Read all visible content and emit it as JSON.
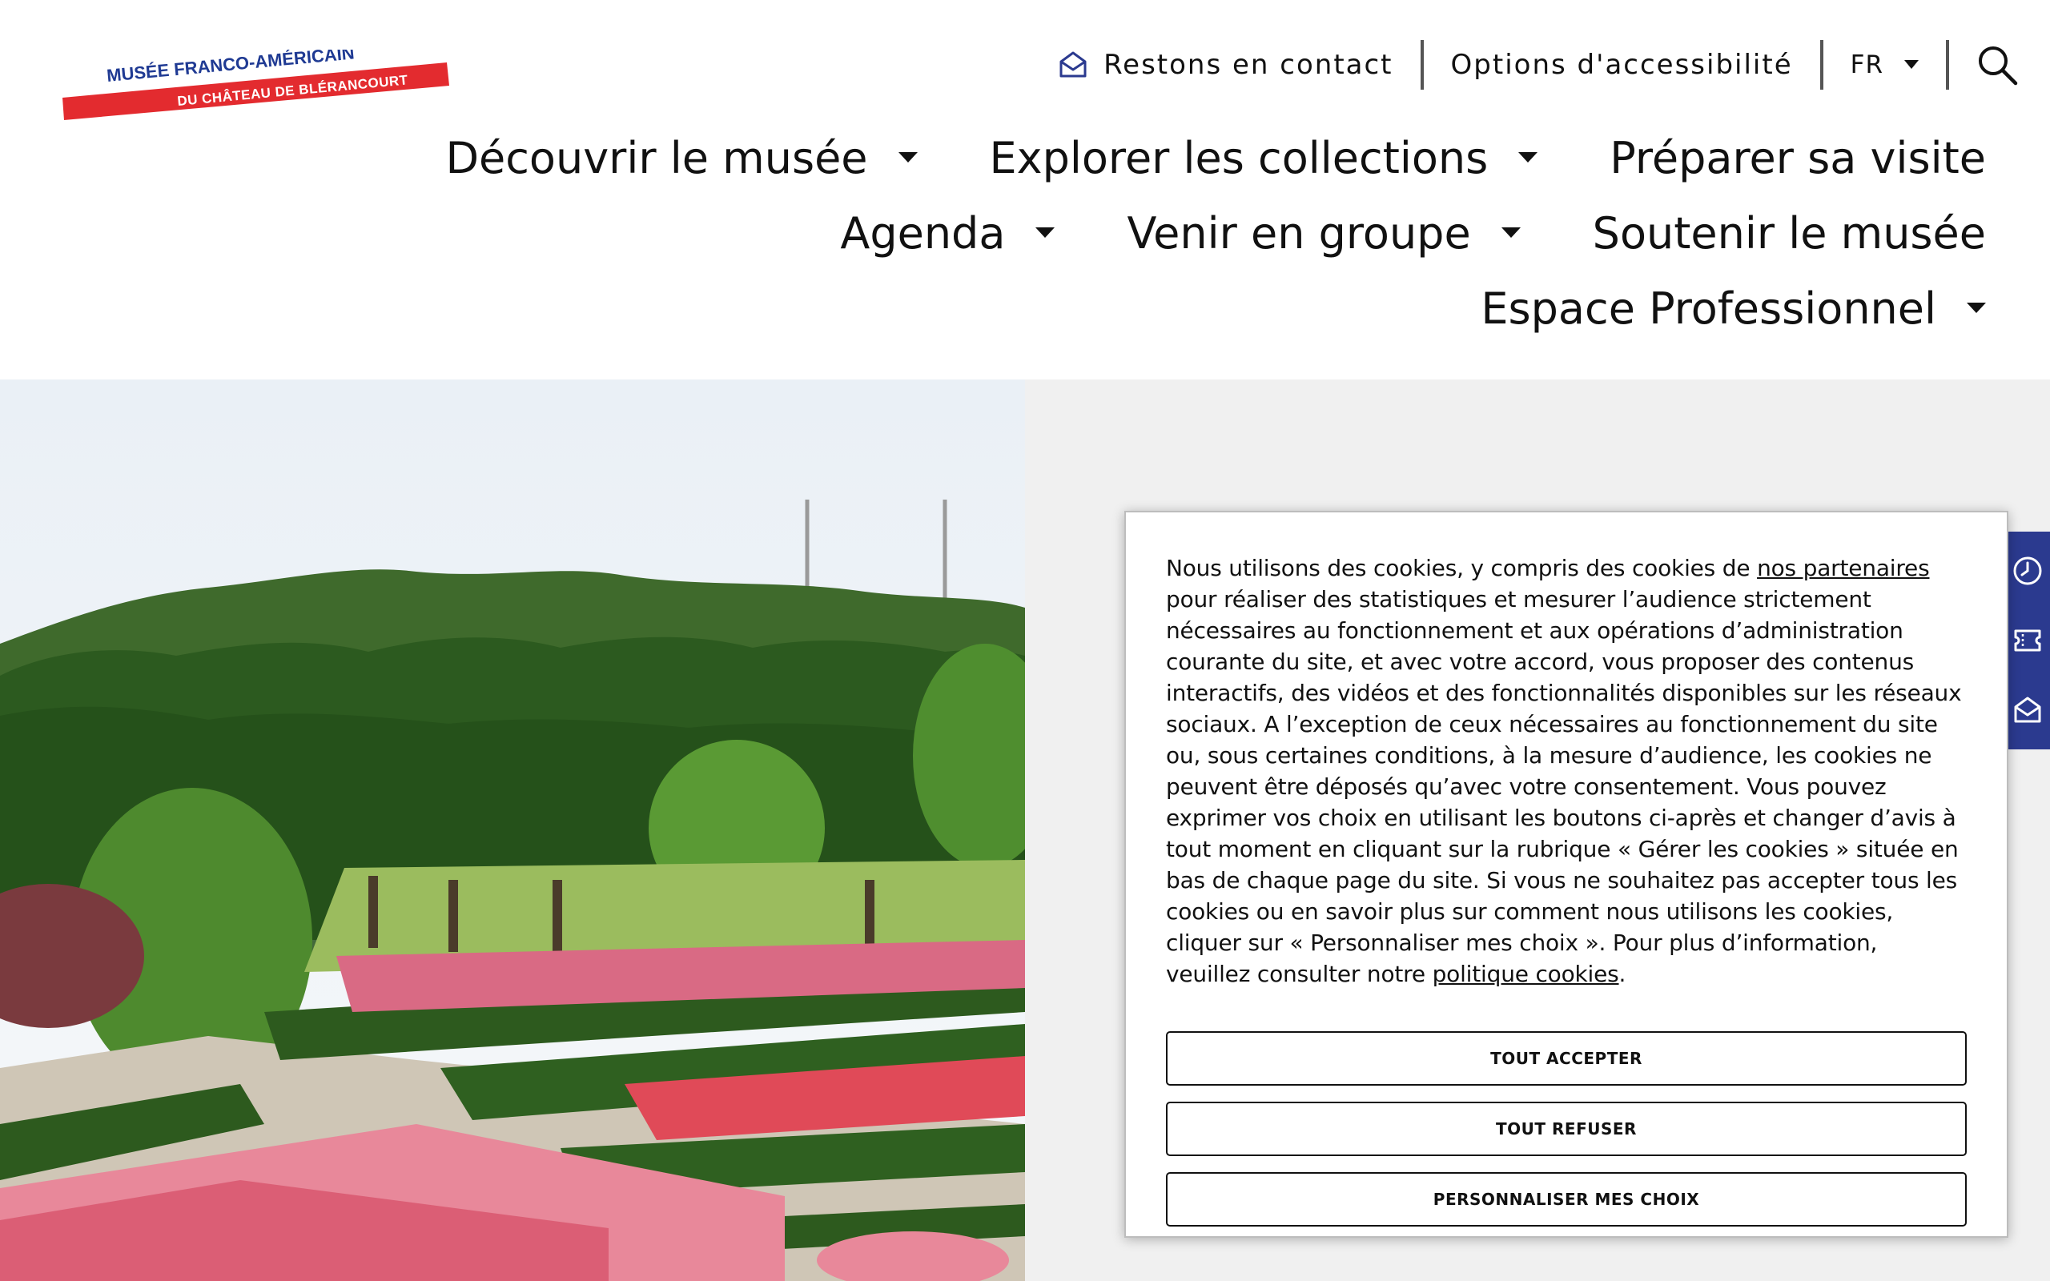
{
  "logo": {
    "line1": "MUSÉE FRANCO-AMÉRICAIN",
    "line2": "DU CHÂTEAU DE BLÉRANCOURT"
  },
  "utility": {
    "contact": "Restons en contact",
    "accessibility": "Options d'accessibilité",
    "language": "FR"
  },
  "nav": {
    "row1": [
      {
        "label": "Découvrir le musée",
        "dropdown": true
      },
      {
        "label": "Explorer les collections",
        "dropdown": true
      },
      {
        "label": "Préparer sa visite",
        "dropdown": false
      }
    ],
    "row2": [
      {
        "label": "Agenda",
        "dropdown": true
      },
      {
        "label": "Venir en groupe",
        "dropdown": true
      },
      {
        "label": "Soutenir le musée",
        "dropdown": false
      }
    ],
    "row3": [
      {
        "label": "Espace Professionnel",
        "dropdown": true
      }
    ]
  },
  "side_tools": [
    "clock-icon",
    "ticket-icon",
    "envelope-icon"
  ],
  "cookie": {
    "text_1": "Nous utilisons des cookies, y compris des cookies de ",
    "link_partners": "nos partenaires",
    "text_2": " pour réaliser des statistiques et mesurer l’audience strictement nécessaires au fonctionnement et aux opérations d’administration courante du site, et avec votre accord, vous proposer des contenus interactifs, des vidéos et des fonctionnalités disponibles sur les réseaux sociaux. A l’exception de ceux nécessaires au fonctionnement du site ou, sous certaines conditions, à la mesure d’audience, les cookies ne peuvent être déposés qu’avec votre consentement. Vous pouvez exprimer vos choix en utilisant les boutons ci-après et changer d’avis à tout moment en cliquant sur la rubrique « Gérer les cookies » située en bas de chaque page du site. Si vous ne souhaitez pas accepter tous les cookies ou en savoir plus sur comment nous utilisons les cookies, cliquer sur « Personnaliser mes choix ». Pour plus d’information, veuillez consulter notre ",
    "link_policy": "politique cookies",
    "text_3": ".",
    "accept": "TOUT ACCEPTER",
    "refuse": "TOUT REFUSER",
    "customize": "PERSONNALISER MES CHOIX"
  },
  "colors": {
    "brand_red": "#e32b2f",
    "brand_blue": "#1f3a93",
    "side_tools_bg": "#2b3a8f",
    "hero_grey": "#f0f0f0"
  }
}
